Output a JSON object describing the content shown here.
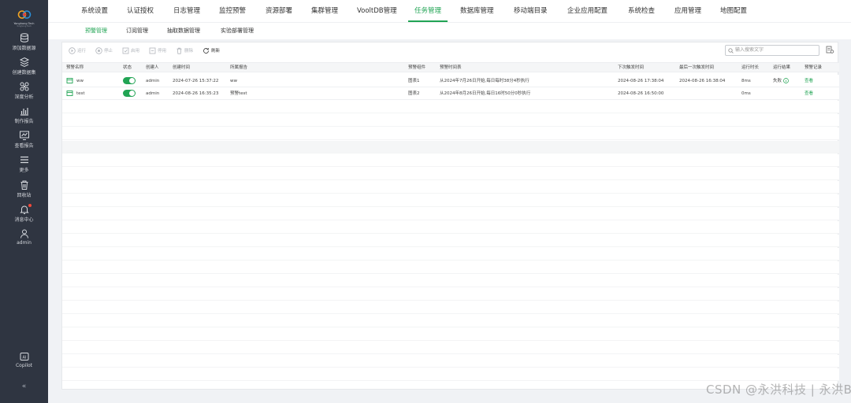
{
  "brand": {
    "name": "Yonghong Tech",
    "tagline": "Yonghong Tech"
  },
  "sidebar": {
    "items": [
      {
        "label": "添加数据源",
        "icon": "database-icon"
      },
      {
        "label": "创建数据集",
        "icon": "dataset-icon"
      },
      {
        "label": "深度分析",
        "icon": "analysis-icon"
      },
      {
        "label": "制作报告",
        "icon": "report-icon"
      },
      {
        "label": "查看报告",
        "icon": "view-report-icon"
      },
      {
        "label": "更多",
        "icon": "menu-icon"
      },
      {
        "label": "回收站",
        "icon": "trash-icon"
      },
      {
        "label": "消息中心",
        "icon": "bell-icon"
      },
      {
        "label": "admin",
        "icon": "user-icon"
      }
    ],
    "copilot": "Copilot",
    "collapse": "«"
  },
  "topnav": {
    "tabs": [
      "系统设置",
      "认证授权",
      "日志管理",
      "监控预警",
      "资源部署",
      "集群管理",
      "VooltDB管理",
      "任务管理",
      "数据库管理",
      "移动端目录",
      "企业应用配置",
      "系统检查",
      "应用管理",
      "地图配置"
    ],
    "active": "任务管理"
  },
  "subnav": {
    "tabs": [
      "预警管理",
      "订阅管理",
      "抽取数据管理",
      "实验部署管理"
    ],
    "active": "预警管理"
  },
  "toolbar": {
    "run": "运行",
    "stop": "停止",
    "enable": "启用",
    "disable": "停用",
    "delete": "删除",
    "refresh": "刷新",
    "search_placeholder": "输入搜索文字"
  },
  "table": {
    "columns": [
      "预警名称",
      "状态",
      "创建人",
      "创建时间",
      "所属报告",
      "预警组件",
      "预警时间表",
      "下次触发时间",
      "最后一次触发时间",
      "运行时长",
      "运行结果",
      "预警记录"
    ],
    "rows": [
      {
        "name": "ww",
        "status": "on",
        "creator": "admin",
        "created": "2024-07-26 15:37:22",
        "report": "ww",
        "component": "图表1",
        "schedule": "从2024年7月26日开始,每日每时38分4秒执行",
        "next": "2024-08-26 17:38:04",
        "last": "2024-08-26 16:38:04",
        "duration": "8ms",
        "result": "失败",
        "record": "查看"
      },
      {
        "name": "test",
        "status": "on",
        "creator": "admin",
        "created": "2024-08-26 16:35:23",
        "report": "预警test",
        "component": "图表2",
        "schedule": "从2024年8月26日开始,每日16时50分0秒执行",
        "next": "2024-08-26 16:50:00",
        "last": "",
        "duration": "0ms",
        "result": "",
        "record": "查看"
      }
    ]
  },
  "watermark": "CSDN @永洪科技 | 永洪BI",
  "colors": {
    "accent": "#21a454",
    "sidebar": "#2f3541"
  }
}
